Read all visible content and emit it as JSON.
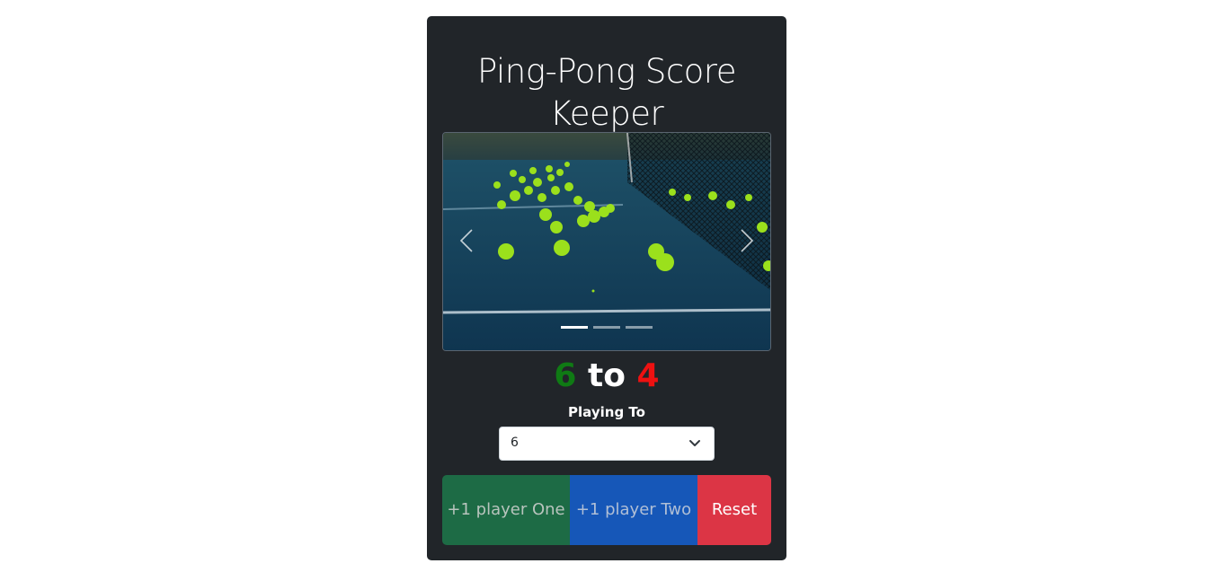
{
  "title": "Ping-Pong Score Keeper",
  "carousel": {
    "image_alt": "tennis balls on court",
    "prev_icon": "chevron-left-icon",
    "next_icon": "chevron-right-icon",
    "slide_count": 3,
    "active_slide": 1
  },
  "score": {
    "player_one": "6",
    "separator": "to",
    "player_two": "4",
    "player_one_color": "#0f7a14",
    "player_two_color": "#ee1111"
  },
  "playing_to": {
    "label": "Playing To",
    "selected": "6",
    "icon": "chevron-down-icon"
  },
  "buttons": {
    "player_one": "+1 player One",
    "player_two": "+1 player Two",
    "reset": "Reset",
    "player_one_color": "#1d6b45",
    "player_two_color": "#1657b8",
    "reset_color": "#dc3545"
  }
}
